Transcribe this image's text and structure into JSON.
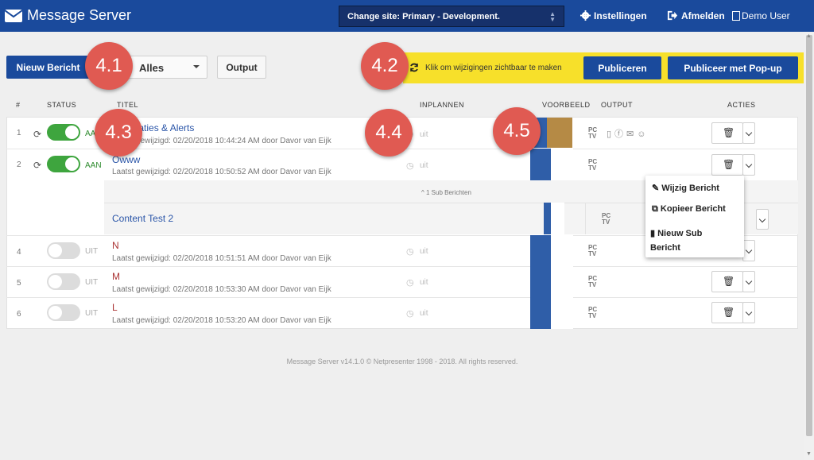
{
  "header": {
    "app_title": "Message Server",
    "site_select": "Change site: Primary - Development.",
    "settings": "Instellingen",
    "logout": "Afmelden",
    "user": "Demo User"
  },
  "toolbar": {
    "new_message": "Nieuw Bericht",
    "filter_value": "Alles",
    "output": "Output",
    "publish_note": "Klik om wijzigingen zichtbaar te maken",
    "publish": "Publiceren",
    "publish_popup": "Publiceer met Pop-up"
  },
  "columns": {
    "num": "#",
    "status": "STATUS",
    "title": "TITEL",
    "schedule": "INPLANNEN",
    "preview": "VOORBEELD",
    "output": "OUTPUT",
    "actions": "ACTIES"
  },
  "rows": [
    {
      "num": "1",
      "state": "AAN",
      "title": "Notificaties & Alerts",
      "meta": "Laatst gewijzigd: 02/20/2018 10:44:24 AM door Davor van Eijk",
      "schedule": "uit",
      "output_label": "PC TV"
    },
    {
      "num": "2",
      "state": "AAN",
      "title": "Owww",
      "meta": "Laatst gewijzigd: 02/20/2018 10:50:52 AM door Davor van Eijk",
      "schedule": "uit",
      "output_label": "PC TV"
    },
    {
      "num": "4",
      "state": "UIT",
      "title": "N",
      "meta": "Laatst gewijzigd: 02/20/2018 10:51:51 AM door Davor van Eijk",
      "schedule": "uit",
      "output_label": "PC TV"
    },
    {
      "num": "5",
      "state": "UIT",
      "title": "M",
      "meta": "Laatst gewijzigd: 02/20/2018 10:53:30 AM door Davor van Eijk",
      "schedule": "uit",
      "output_label": "PC TV"
    },
    {
      "num": "6",
      "state": "UIT",
      "title": "L",
      "meta": "Laatst gewijzigd: 02/20/2018 10:53:20 AM door Davor van Eijk",
      "schedule": "uit",
      "output_label": "PC TV"
    }
  ],
  "sub": {
    "toggle_label": "1 Sub Berichten",
    "title": "Content Test 2",
    "output_label": "PC TV"
  },
  "menu": {
    "edit": "Wijzig Bericht",
    "copy": "Kopieer Bericht",
    "new_sub": "Nieuw Sub Bericht"
  },
  "badges": [
    "4.1",
    "4.2",
    "4.3",
    "4.4",
    "4.5"
  ],
  "footer": "Message Server v14.1.0 © Netpresenter 1998 - 2018. All rights reserved.",
  "colors": {
    "brand": "#1a4a9c",
    "on": "#3ea53e",
    "badge": "#e05a52",
    "publish_bar": "#f7e02a"
  }
}
